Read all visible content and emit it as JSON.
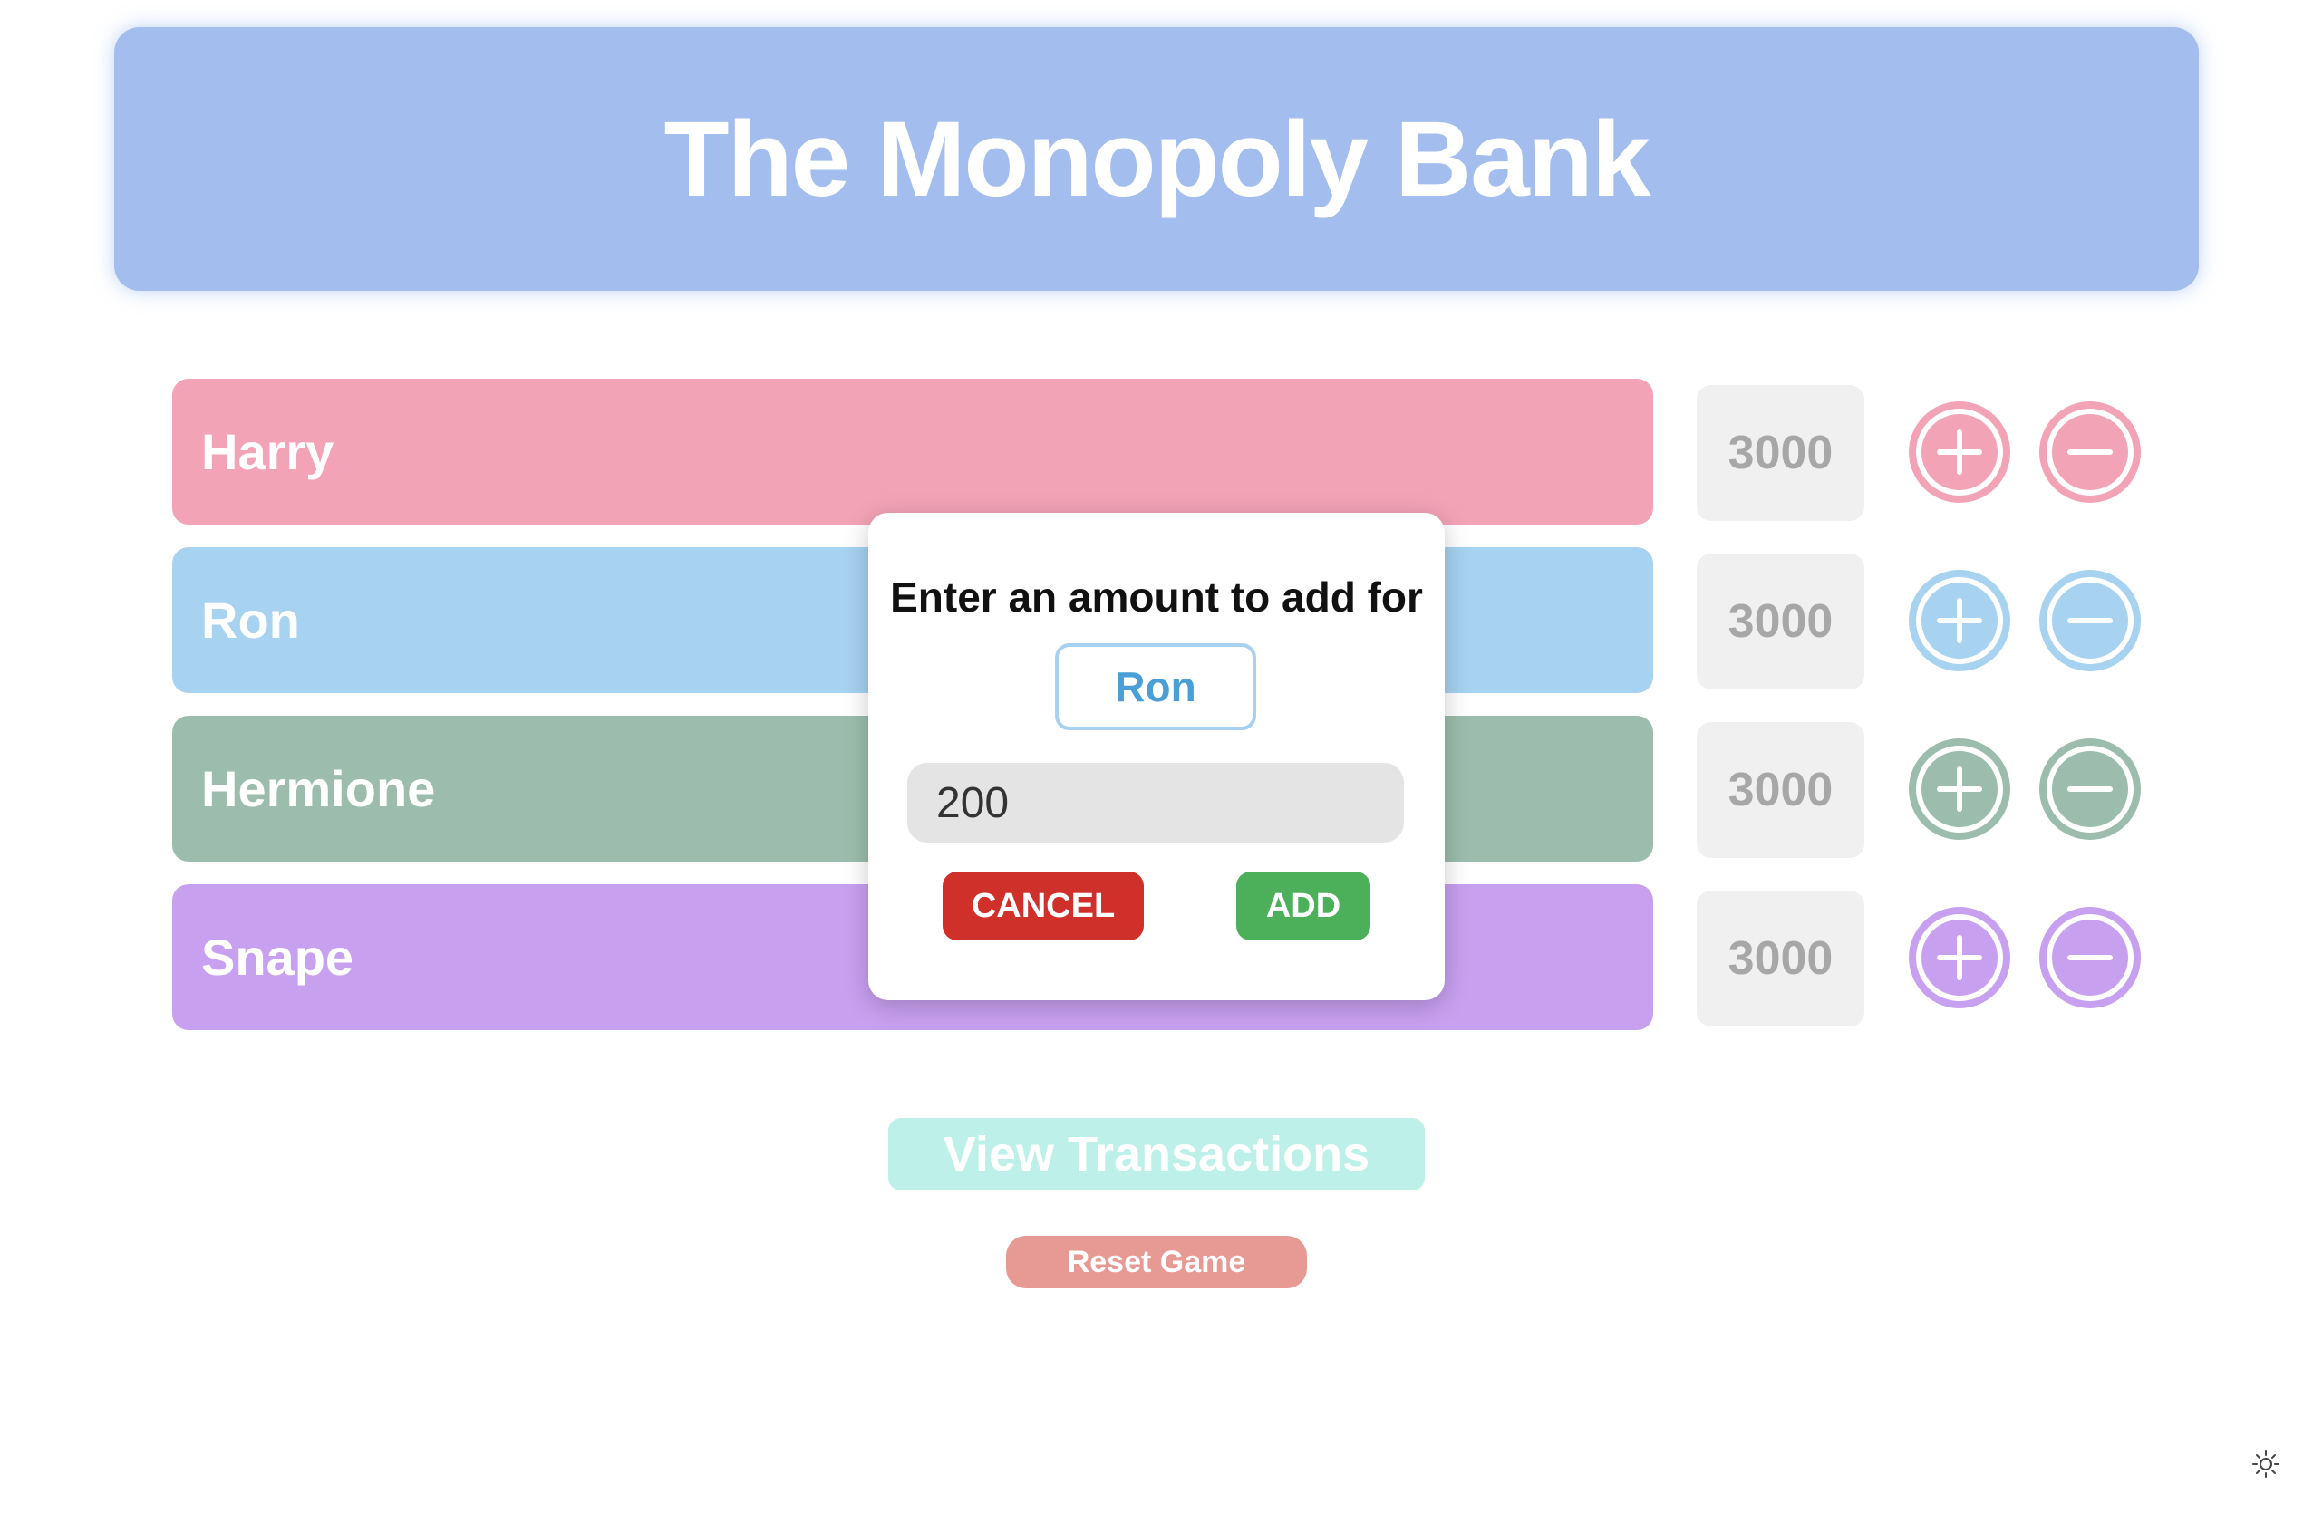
{
  "app": {
    "title": "The Monopoly Bank"
  },
  "players": [
    {
      "name": "Harry",
      "balance": "3000",
      "color": "#f3a3b6",
      "button_color": "#f3a3b6"
    },
    {
      "name": "Ron",
      "balance": "3000",
      "color": "#a7d2f0",
      "button_color": "#a7d2f0"
    },
    {
      "name": "Hermione",
      "balance": "3000",
      "color": "#9cbdad",
      "button_color": "#9cbdad"
    },
    {
      "name": "Snape",
      "balance": "3000",
      "color": "#c8a0f0",
      "button_color": "#c8a0f0"
    }
  ],
  "icons": {
    "add": "plus-circle-icon",
    "subtract": "minus-circle-icon",
    "theme": "sun-icon"
  },
  "modal": {
    "title": "Enter an amount to add for",
    "player_name": "Ron",
    "amount_value": "200",
    "cancel_label": "CANCEL",
    "add_label": "ADD",
    "cancel_color": "#d0302a",
    "add_color": "#4caf5a"
  },
  "actions": {
    "view_transactions_label": "View Transactions",
    "reset_label": "Reset Game"
  },
  "colors": {
    "header_bg": "#a2bdee",
    "balance_bg": "#f0f0f0"
  }
}
